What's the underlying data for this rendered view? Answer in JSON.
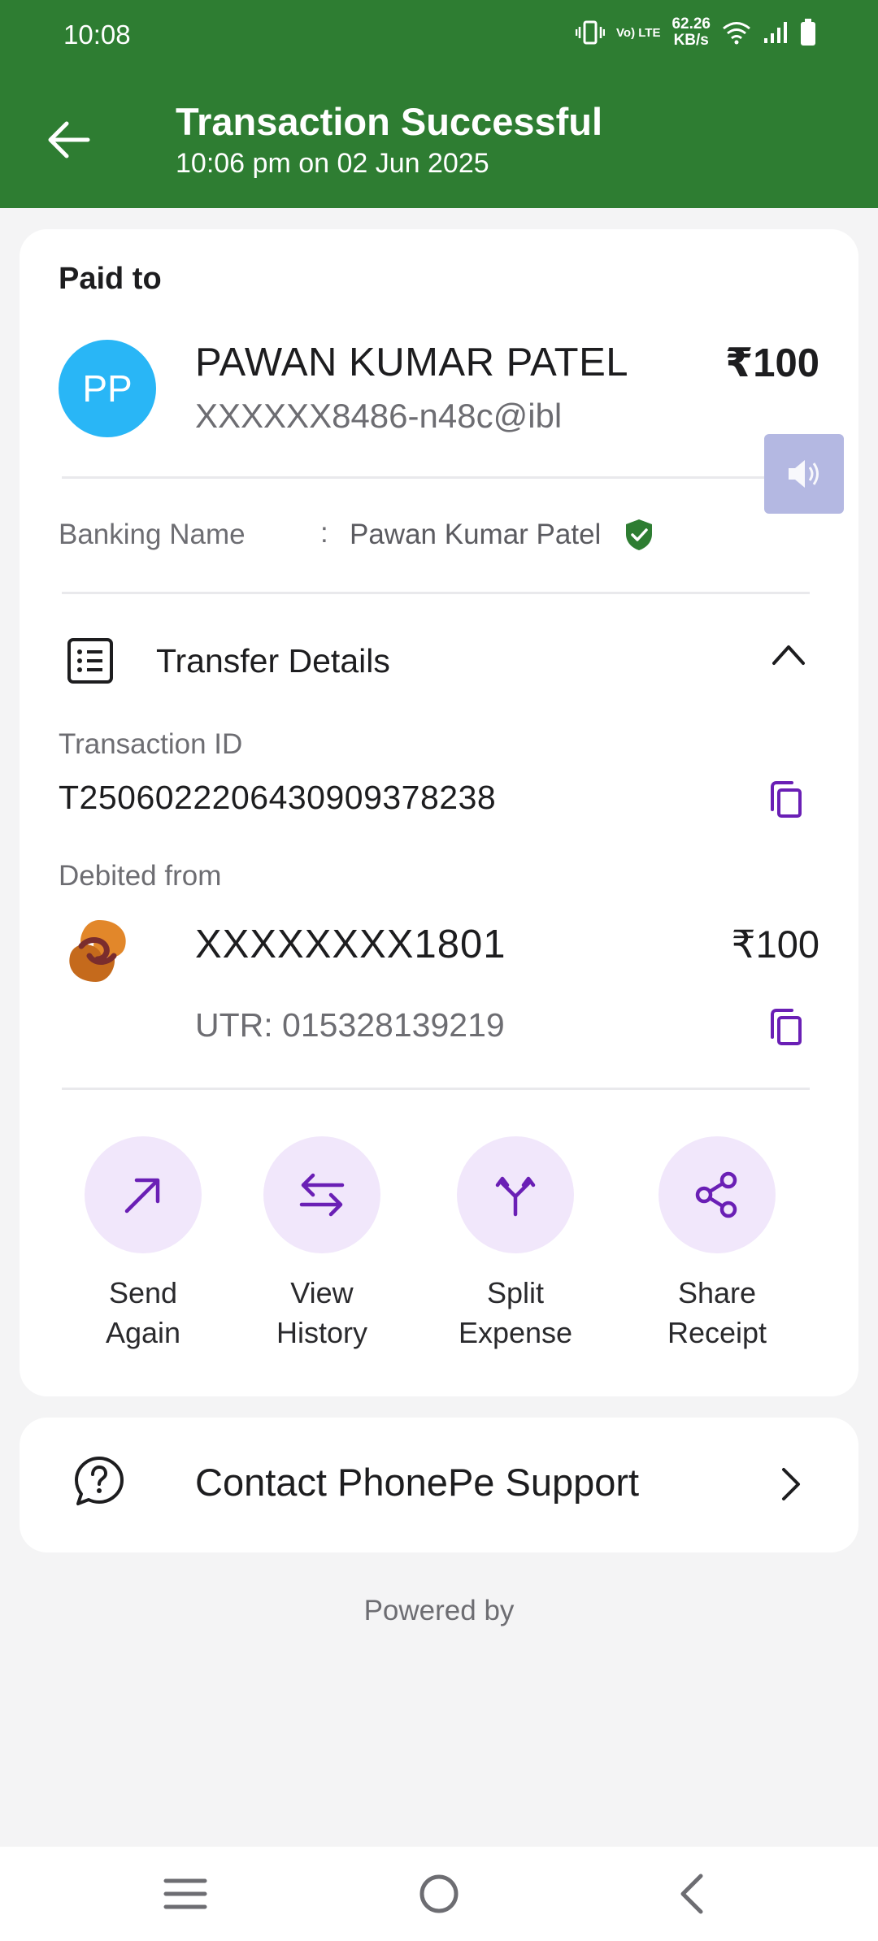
{
  "status_bar": {
    "time": "10:08",
    "network": "Vo) LTE",
    "speed_value": "62.26",
    "speed_unit": "KB/s"
  },
  "header": {
    "title": "Transaction Successful",
    "subtitle": "10:06 pm on 02 Jun 2025"
  },
  "payment": {
    "paid_to_label": "Paid to",
    "avatar_initials": "PP",
    "payee_name": "PAWAN KUMAR PATEL",
    "payee_vpa": "XXXXXX8486-n48c@ibl",
    "amount": "₹100",
    "banking_name_label": "Banking Name",
    "banking_name_separator": ":",
    "banking_name_value": "Pawan Kumar Patel"
  },
  "transfer_details": {
    "label": "Transfer Details",
    "transaction_id_label": "Transaction ID",
    "transaction_id": "T2506022206430909378238",
    "debited_from_label": "Debited from",
    "account": "XXXXXXXX1801",
    "debited_amount": "₹100",
    "utr": "UTR: 015328139219"
  },
  "actions": [
    {
      "line1": "Send",
      "line2": "Again",
      "icon": "arrow-up-right-icon"
    },
    {
      "line1": "View",
      "line2": "History",
      "icon": "swap-arrows-icon"
    },
    {
      "line1": "Split",
      "line2": "Expense",
      "icon": "split-icon"
    },
    {
      "line1": "Share",
      "line2": "Receipt",
      "icon": "share-icon"
    }
  ],
  "support": {
    "label": "Contact PhonePe Support"
  },
  "footer": {
    "powered_by": "Powered by"
  },
  "colors": {
    "header_green": "#2e7d32",
    "accent_purple": "#6a1fb5",
    "action_bg": "#f1e7fb",
    "avatar_blue": "#29b6f6",
    "verified_green": "#2e7d32"
  }
}
